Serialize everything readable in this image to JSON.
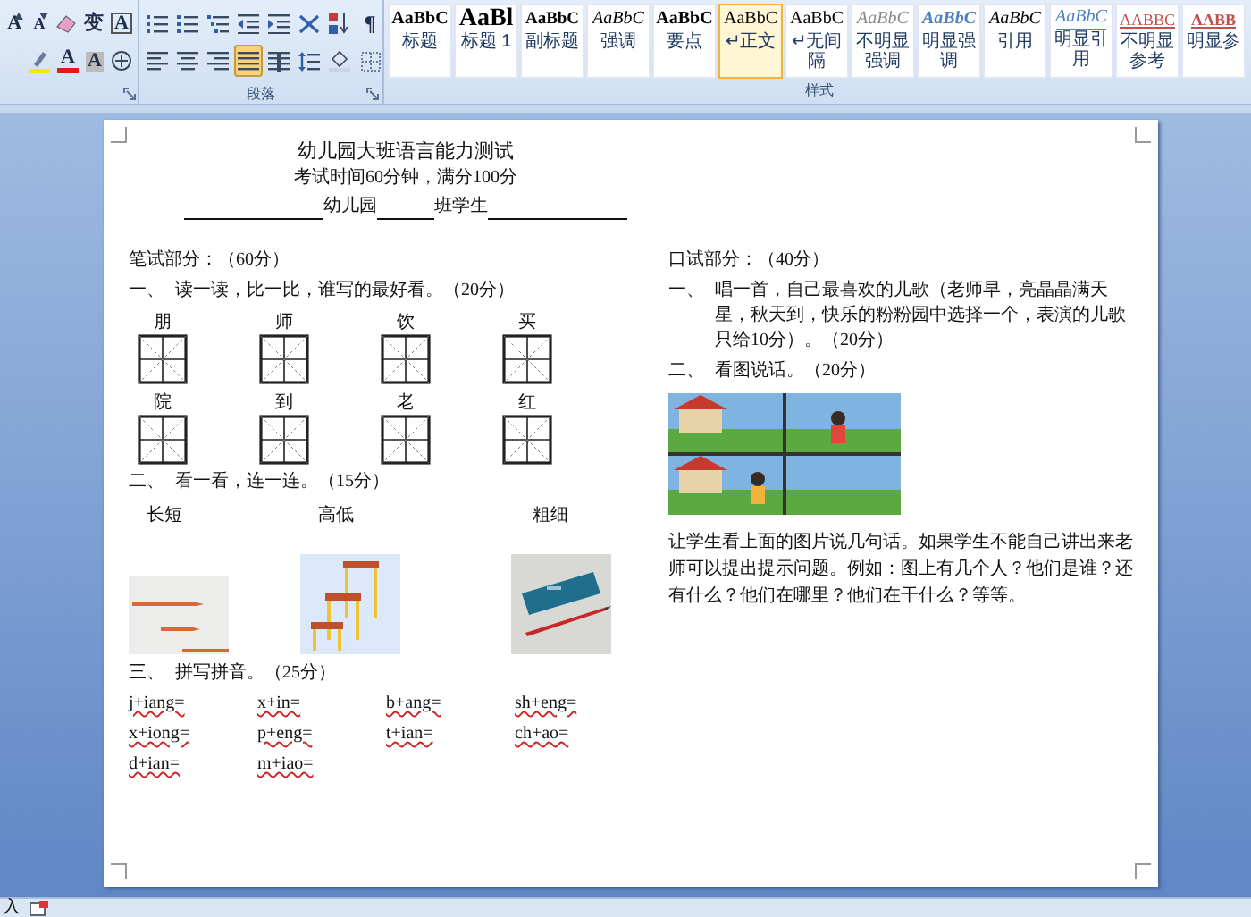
{
  "ribbon": {
    "font_group": {
      "row1": [
        {
          "kind": "grow",
          "glyph": "A",
          "selected": false
        },
        {
          "kind": "shrink",
          "glyph": "A",
          "selected": false
        },
        {
          "kind": "clear",
          "selected": false
        },
        {
          "kind": "phonetic",
          "glyph": "变",
          "selected": false
        },
        {
          "kind": "border-char",
          "glyph": "A",
          "selected": false
        }
      ],
      "row2": [
        {
          "kind": "highlight",
          "selected": false
        },
        {
          "kind": "font-color",
          "glyph": "A",
          "selected": false
        },
        {
          "kind": "char-shade",
          "glyph": "A",
          "selected": false
        },
        {
          "kind": "enclose",
          "selected": false
        }
      ]
    },
    "paragraph_group": {
      "label": "段落",
      "row1": [
        {
          "kind": "bullets",
          "selected": false
        },
        {
          "kind": "numbering",
          "selected": false
        },
        {
          "kind": "multilevel",
          "selected": false
        },
        {
          "kind": "outdent",
          "selected": false
        },
        {
          "kind": "indent",
          "selected": false
        },
        {
          "kind": "asian",
          "selected": false
        },
        {
          "kind": "sort",
          "selected": false
        },
        {
          "kind": "pilcrow",
          "glyph": "¶",
          "selected": false
        }
      ],
      "row2": [
        {
          "kind": "align-left",
          "selected": false
        },
        {
          "kind": "align-center",
          "selected": false
        },
        {
          "kind": "align-right",
          "selected": false
        },
        {
          "kind": "justify",
          "selected": true
        },
        {
          "kind": "distribute",
          "selected": false
        },
        {
          "kind": "line-spacing",
          "selected": false
        },
        {
          "kind": "shading",
          "selected": false
        },
        {
          "kind": "borders",
          "selected": false
        }
      ]
    },
    "styles_group": {
      "label": "样式",
      "styles": [
        {
          "kind": "title",
          "preview": "AaBbC",
          "label": "标题",
          "selected": false
        },
        {
          "kind": "heading",
          "preview": "AaBl",
          "label": "标题 1",
          "selected": false
        },
        {
          "kind": "subtitle",
          "preview": "AaBbC",
          "label": "副标题",
          "selected": false
        },
        {
          "kind": "emphasis",
          "preview": "AaBbC",
          "label": "强调",
          "selected": false
        },
        {
          "kind": "strong",
          "preview": "AaBbC",
          "label": "要点",
          "selected": false
        },
        {
          "kind": "normal",
          "preview": "AaBbC",
          "label": "↵正文",
          "selected": true
        },
        {
          "kind": "normal",
          "preview": "AaBbC",
          "label": "↵无间隔",
          "selected": false
        },
        {
          "kind": "subtle-emphasis",
          "preview": "AaBbC",
          "label": "不明显强调",
          "selected": false
        },
        {
          "kind": "intense-emphasis",
          "preview": "AaBbC",
          "label": "明显强调",
          "selected": false
        },
        {
          "kind": "quote",
          "preview": "AaBbC",
          "label": "引用",
          "selected": false
        },
        {
          "kind": "intense-quote",
          "preview": "AaBbC",
          "label": "明显引用",
          "selected": false
        },
        {
          "kind": "subtle-reference",
          "preview": "AABBC",
          "label": "不明显参考",
          "selected": false
        },
        {
          "kind": "intense-reference",
          "preview": "AABB",
          "label": "明显参",
          "selected": false
        }
      ]
    }
  },
  "document": {
    "title": "幼儿园大班语言能力测试",
    "subtitle": "考试时间60分钟，满分100分",
    "name_line": [
      {
        "kind": "blank"
      },
      {
        "kind": "text",
        "text": "幼儿园"
      },
      {
        "kind": "blank"
      },
      {
        "kind": "text",
        "text": "班学生"
      },
      {
        "kind": "blank"
      }
    ],
    "written": {
      "heading": "笔试部分：（60分）",
      "q1": {
        "number": "一、",
        "text": "读一读，比一比，谁写的最好看。（20分）",
        "characters": [
          [
            "朋",
            "师",
            "饮",
            "买"
          ],
          [
            "院",
            "到",
            "老",
            "红"
          ]
        ]
      },
      "q2": {
        "number": "二、",
        "text": "看一看，连一连。（15分）",
        "words": [
          "长短",
          "高低",
          "粗细"
        ],
        "pictures": [
          {
            "kind": "picture"
          },
          {
            "kind": "picture"
          },
          {
            "kind": "picture"
          }
        ]
      },
      "q3": {
        "number": "三、",
        "text": "拼写拼音。（25分）",
        "items": [
          "j+iang=",
          "x+in=",
          "b+ang=",
          "sh+eng=",
          "x+iong=",
          "p+eng=",
          "t+ian=",
          "ch+ao=",
          "d+ian=",
          "m+iao="
        ]
      }
    },
    "oral": {
      "heading": "口试部分：（40分）",
      "q1": {
        "number": "一、",
        "text": "唱一首，自己最喜欢的儿歌（老师早，亮晶晶满天星，秋天到，快乐的粉粉园中选择一个，表演的儿歌只给10分）。（20分）"
      },
      "q2": {
        "number": "二、",
        "text": "看图说话。（20分）",
        "picture": {
          "kind": "picture"
        }
      },
      "prompt": "让学生看上面的图片说几句话。如果学生不能自己讲出来老师可以提出提示问题。例如：图上有几个人？他们是谁？还有什么？他们在哪里？他们在干什么？等等。"
    }
  },
  "status_bar": {
    "mode": "入"
  }
}
